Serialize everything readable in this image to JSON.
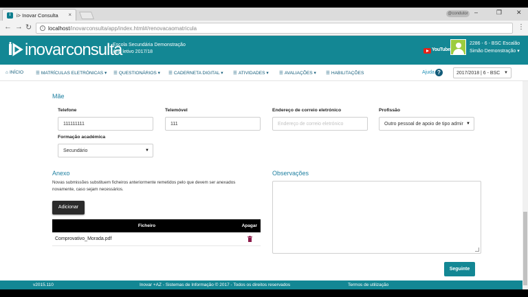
{
  "browser": {
    "tab_title": "i> Inovar Consulta",
    "tab_close": "×",
    "user_pill": "@condutor",
    "url_host": "localhost",
    "url_path": "/inovarconsulta/app/index.html#/renovacaomatricula",
    "window_controls": [
      "–",
      "❐",
      "✕"
    ]
  },
  "header": {
    "logo_word1": "inovar",
    "logo_word2": "consulta",
    "school_name": "Escola Secundária Demonstração",
    "school_year": "Ano letivo 2017/18",
    "youtube_label": "YouTube",
    "user_line1": "2286 - 6 - BSC  Escalão",
    "user_line2": "Simão Demonstração ▾"
  },
  "menu": {
    "items": [
      {
        "icon": "home-icon",
        "glyph": "⌂",
        "label": "INÍCIO"
      },
      {
        "icon": "list-icon",
        "glyph": "☰",
        "label": "MATRÍCULAS ELETRÓNICAS ▾"
      },
      {
        "icon": "list-icon",
        "glyph": "☰",
        "label": "QUESTIONÁRIOS ▾"
      },
      {
        "icon": "list-icon",
        "glyph": "☰",
        "label": "CADERNETA DIGITAL ▾"
      },
      {
        "icon": "list-icon",
        "glyph": "☰",
        "label": "ATIVIDADES ▾"
      },
      {
        "icon": "list-icon",
        "glyph": "☰",
        "label": "AVALIAÇÕES ▾"
      },
      {
        "icon": "list-icon",
        "glyph": "☰",
        "label": "HABILITAÇÕES"
      }
    ],
    "help_label": "Ajuda",
    "help_glyph": "?",
    "year_select": "2017/2018 | 6 - BSC"
  },
  "mother": {
    "title": "Mãe",
    "phone_label": "Telefone",
    "phone_value": "111111111",
    "mobile_label": "Telemóvel",
    "mobile_value": "111",
    "email_label": "Endereço de correio eletrónico",
    "email_placeholder": "Endereço de correio eletrónico",
    "profession_label": "Profissão",
    "profession_value": "Outro pessoal de apoio de tipo admir",
    "education_label": "Formação académica",
    "education_value": "Secundário"
  },
  "attachment": {
    "title": "Anexo",
    "notice": "Novas submissões substituem ficheiros anteriormente remetidos pelo que devem ser anexados novamente, caso sejam necessários.",
    "add_button": "Adicionar",
    "col_file": "Ficheiro",
    "col_delete": "Apagar",
    "files": [
      {
        "name": "Comprovativo_Morada.pdf"
      }
    ]
  },
  "observations": {
    "title": "Observações"
  },
  "next_button": "Seguinte",
  "footer": {
    "version": "v2015.110",
    "copyright": "Inovar +AZ - Sistemas de Informação © 2017 - Todos os direitos reservados",
    "terms": "Termos de utilização"
  },
  "colors": {
    "brand_teal": "#138794",
    "link_blue": "#1e7fa0",
    "button_dark": "#2b2b2b",
    "youtube_red": "#e62117"
  }
}
